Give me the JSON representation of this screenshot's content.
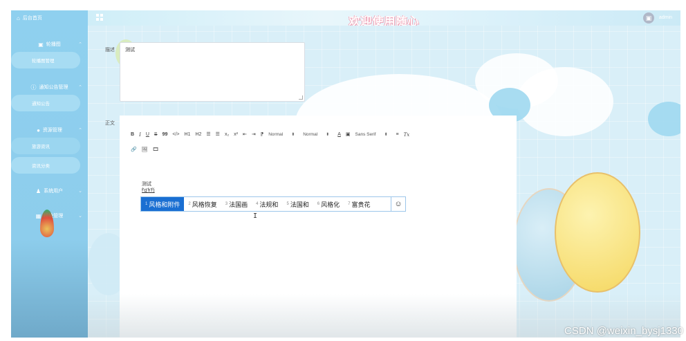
{
  "sidebar": {
    "home_label": "后台首页",
    "groups": [
      {
        "label": "轮播图",
        "icon": "image-icon",
        "items": [
          "轮播图管理"
        ]
      },
      {
        "label": "通知公告管理",
        "icon": "info-icon",
        "items": [
          "通知公告"
        ]
      },
      {
        "label": "资源管理",
        "icon": "location-pin-icon",
        "items": [
          "旅游资讯",
          "资讯分类"
        ]
      },
      {
        "label": "系统用户",
        "icon": "user-icon",
        "items": []
      },
      {
        "label": "模块管理",
        "icon": "grid-icon",
        "items": []
      }
    ]
  },
  "header": {
    "title": "欢迎使用随心",
    "username": "admin"
  },
  "form": {
    "desc_label": "描述",
    "desc_value": "测试",
    "body_label": "正文"
  },
  "editor": {
    "toolbar": {
      "bold": "B",
      "italic": "I",
      "underline": "U",
      "strike": "S",
      "blockquote": "99",
      "code": "</>",
      "h1": "H1",
      "h2": "H2",
      "ordered_list": "☰",
      "bullet_list": "☰",
      "subscript": "x₂",
      "superscript": "x²",
      "outdent": "⇤",
      "indent": "⇥",
      "direction": "⁋",
      "size_select": "Normal",
      "header_select": "Normal",
      "color": "A",
      "background": "▣",
      "font_select": "Sans Serif",
      "align": "≡",
      "clean": "Tx",
      "link": "🔗",
      "image": "🖼",
      "video": "🎞"
    },
    "content_line1": "测试",
    "composition": "f'g'h'f'j"
  },
  "ime": {
    "candidates": [
      {
        "n": "1",
        "text": "风格和附件"
      },
      {
        "n": "2",
        "text": "风格恢复"
      },
      {
        "n": "3",
        "text": "法国画"
      },
      {
        "n": "4",
        "text": "法规和"
      },
      {
        "n": "5",
        "text": "法国和"
      },
      {
        "n": "6",
        "text": "风格化"
      },
      {
        "n": "7",
        "text": "富贵花"
      }
    ],
    "emoji": "☺"
  },
  "watermark": "CSDN @weixin_bysj1330",
  "colors": {
    "sidebar_bg": "#8fd0ef",
    "ime_highlight": "#1a6fd2",
    "title_outline": "#f0a0b4"
  }
}
